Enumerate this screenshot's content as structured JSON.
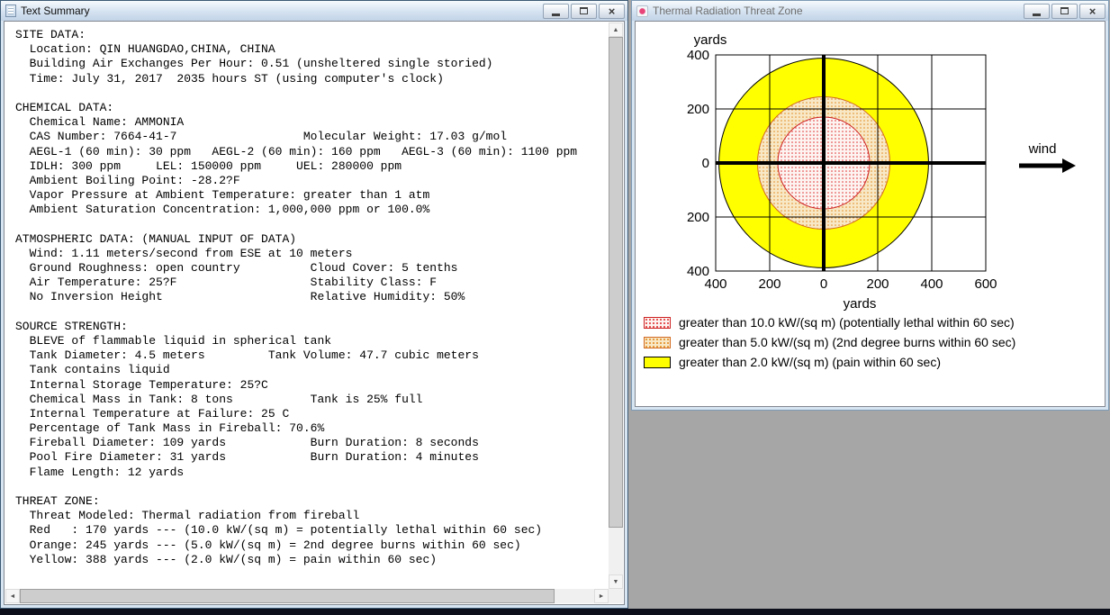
{
  "icons": {
    "close": "×",
    "scroll_up": "▲",
    "scroll_down": "▼",
    "scroll_left": "◄",
    "scroll_right": "►"
  },
  "left_window": {
    "title": "Text Summary",
    "lines": [
      "SITE DATA:",
      "  Location: QIN HUANGDAO,CHINA, CHINA",
      "  Building Air Exchanges Per Hour: 0.51 (unsheltered single storied)",
      "  Time: July 31, 2017  2035 hours ST (using computer's clock)",
      "",
      "CHEMICAL DATA:",
      "  Chemical Name: AMMONIA",
      "  CAS Number: 7664-41-7                  Molecular Weight: 17.03 g/mol",
      "  AEGL-1 (60 min): 30 ppm   AEGL-2 (60 min): 160 ppm   AEGL-3 (60 min): 1100 ppm",
      "  IDLH: 300 ppm     LEL: 150000 ppm     UEL: 280000 ppm",
      "  Ambient Boiling Point: -28.2?F",
      "  Vapor Pressure at Ambient Temperature: greater than 1 atm",
      "  Ambient Saturation Concentration: 1,000,000 ppm or 100.0%",
      "",
      "ATMOSPHERIC DATA: (MANUAL INPUT OF DATA)",
      "  Wind: 1.11 meters/second from ESE at 10 meters",
      "  Ground Roughness: open country          Cloud Cover: 5 tenths",
      "  Air Temperature: 25?F                   Stability Class: F",
      "  No Inversion Height                     Relative Humidity: 50%",
      "",
      "SOURCE STRENGTH:",
      "  BLEVE of flammable liquid in spherical tank",
      "  Tank Diameter: 4.5 meters         Tank Volume: 47.7 cubic meters",
      "  Tank contains liquid",
      "  Internal Storage Temperature: 25?C",
      "  Chemical Mass in Tank: 8 tons           Tank is 25% full",
      "  Internal Temperature at Failure: 25 C",
      "  Percentage of Tank Mass in Fireball: 70.6%",
      "  Fireball Diameter: 109 yards            Burn Duration: 8 seconds",
      "  Pool Fire Diameter: 31 yards            Burn Duration: 4 minutes",
      "  Flame Length: 12 yards",
      "",
      "THREAT ZONE:",
      "  Threat Modeled: Thermal radiation from fireball",
      "  Red   : 170 yards --- (10.0 kW/(sq m) = potentially lethal within 60 sec)",
      "  Orange: 245 yards --- (5.0 kW/(sq m) = 2nd degree burns within 60 sec)",
      "  Yellow: 388 yards --- (2.0 kW/(sq m) = pain within 60 sec)"
    ]
  },
  "right_window": {
    "title": "Thermal Radiation Threat Zone",
    "legend": [
      {
        "zone": "red",
        "label": "greater than 10.0 kW/(sq m) (potentially lethal within 60 sec)"
      },
      {
        "zone": "orange",
        "label": "greater than 5.0 kW/(sq m) (2nd degree burns within 60 sec)"
      },
      {
        "zone": "yellow",
        "label": "greater than 2.0 kW/(sq m) (pain within 60 sec)"
      }
    ]
  },
  "chart_data": {
    "type": "threat-zone-map",
    "title": "Thermal Radiation Threat Zone",
    "xlabel": "yards",
    "ylabel": "yards",
    "xlim": [
      -400,
      600
    ],
    "ylim": [
      -400,
      400
    ],
    "x_tick_values": [
      -400,
      -200,
      0,
      200,
      400,
      600
    ],
    "x_tick_labels": [
      "400",
      "200",
      "0",
      "200",
      "400",
      "600"
    ],
    "y_tick_values": [
      -400,
      -200,
      0,
      200,
      400
    ],
    "y_tick_labels": [
      "400",
      "200",
      "0",
      "200",
      "400"
    ],
    "grid": true,
    "center": [
      0,
      0
    ],
    "zones": [
      {
        "name": "yellow",
        "radius_yards": 388,
        "threshold_kw_per_sqm": 2.0,
        "effect": "pain within 60 sec",
        "style": "solid",
        "fill": "#ffff00",
        "stroke": "#000000"
      },
      {
        "name": "orange",
        "radius_yards": 245,
        "threshold_kw_per_sqm": 5.0,
        "effect": "2nd degree burns within 60 sec",
        "style": "dots",
        "bg": "#f8e8c6",
        "dot": "#e08214",
        "stroke": "#d2691e"
      },
      {
        "name": "red",
        "radius_yards": 170,
        "threshold_kw_per_sqm": 10.0,
        "effect": "potentially lethal within 60 sec",
        "style": "dots",
        "bg": "#fdf4f1",
        "dot": "#dd2222",
        "stroke": "#cc2222"
      }
    ],
    "wind_arrow": {
      "label": "wind",
      "direction": "right"
    }
  }
}
